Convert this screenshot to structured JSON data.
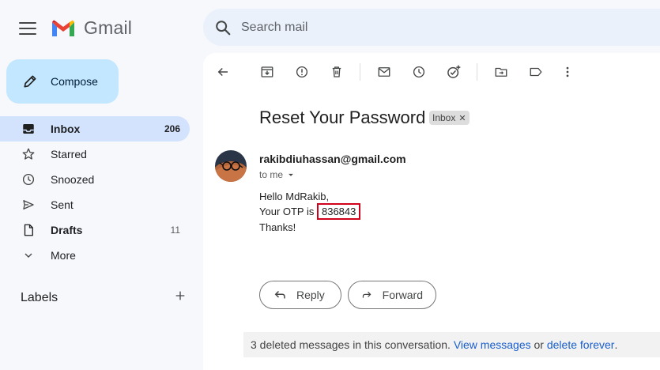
{
  "header": {
    "app_name": "Gmail",
    "search_placeholder": "Search mail"
  },
  "sidebar": {
    "compose_label": "Compose",
    "items": [
      {
        "label": "Inbox",
        "count": "206",
        "icon": "inbox-icon",
        "active": true
      },
      {
        "label": "Starred",
        "count": "",
        "icon": "star-icon"
      },
      {
        "label": "Snoozed",
        "count": "",
        "icon": "clock-icon"
      },
      {
        "label": "Sent",
        "count": "",
        "icon": "send-icon"
      },
      {
        "label": "Drafts",
        "count": "11",
        "icon": "draft-icon"
      },
      {
        "label": "More",
        "count": "",
        "icon": "chevron-down-icon"
      }
    ],
    "labels_heading": "Labels"
  },
  "email": {
    "subject": "Reset Your Password",
    "label_badge": "Inbox",
    "sender": "rakibdiuhassan@gmail.com",
    "recipient": "to me",
    "greeting": "Hello MdRakib,",
    "otp_prefix": "Your OTP is ",
    "otp_code": "836843",
    "closing": "Thanks!"
  },
  "actions": {
    "reply_label": "Reply",
    "forward_label": "Forward"
  },
  "footer": {
    "deleted_text": "3 deleted messages in this conversation.",
    "view_link": "View messages",
    "or_text": "or",
    "delete_link": "delete forever",
    "period": "."
  },
  "colors": {
    "accent": "#c2e7ff",
    "active_nav": "#d3e3fd",
    "highlight_box": "#d0021b",
    "link": "#1a5fcc"
  }
}
